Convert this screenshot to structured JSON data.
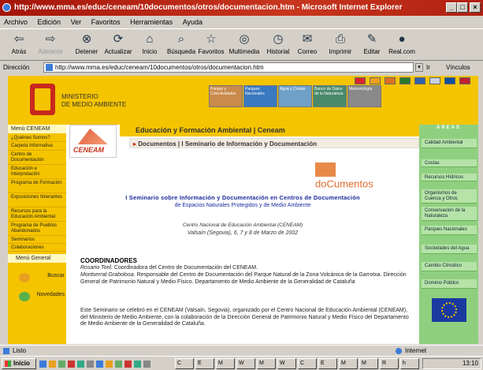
{
  "window": {
    "title": "http://www.mma.es/educ/ceneam/10documentos/otros/documentacion.htm - Microsoft Internet Explorer",
    "controls": [
      "_",
      "□",
      "×"
    ]
  },
  "menu": [
    "Archivo",
    "Edición",
    "Ver",
    "Favoritos",
    "Herramientas",
    "Ayuda"
  ],
  "toolbar": [
    {
      "label": "Atrás",
      "icon": "back-arrow-icon",
      "glyph": "⇦"
    },
    {
      "label": "Adelante",
      "icon": "forward-arrow-icon",
      "glyph": "⇨"
    },
    {
      "label": "Detener",
      "icon": "stop-icon",
      "glyph": "⊗"
    },
    {
      "label": "Actualizar",
      "icon": "refresh-icon",
      "glyph": "⟳"
    },
    {
      "label": "Inicio",
      "icon": "home-icon",
      "glyph": "⌂"
    },
    {
      "label": "Búsqueda",
      "icon": "search-icon",
      "glyph": "⌕"
    },
    {
      "label": "Favoritos",
      "icon": "favorites-icon",
      "glyph": "☆"
    },
    {
      "label": "Multimedia",
      "icon": "multimedia-icon",
      "glyph": "◎"
    },
    {
      "label": "Historial",
      "icon": "history-icon",
      "glyph": "◷"
    },
    {
      "label": "Correo",
      "icon": "mail-icon",
      "glyph": "✉"
    },
    {
      "label": "Imprimir",
      "icon": "print-icon",
      "glyph": "⎙"
    },
    {
      "label": "Editar",
      "icon": "edit-icon",
      "glyph": "✎"
    },
    {
      "label": "Real.com",
      "icon": "real-icon",
      "glyph": "●"
    }
  ],
  "address": {
    "label": "Dirección",
    "url": "http://www.mma.es/educ/ceneam/10documentos/otros/documentacion.htm",
    "go": "Ir",
    "links": "Vínculos"
  },
  "header": {
    "ministry_line1": "MINISTERIO",
    "ministry_line2": "DE MEDIO AMBIENTE",
    "photos": [
      "Parque y Colectividades",
      "Parques Nacionales",
      "Agua y Costas",
      "Banco de Datos de la Naturaleza",
      "Meteorología"
    ]
  },
  "left_nav": {
    "header": "Menú CENEAM",
    "items": [
      "¿Quiénes Somos?",
      "Carpeta Informativa",
      "Centro de Documentación",
      "Educación e Interpretación",
      "Programa de Formación",
      "Exposiciones Itinerantes",
      "Recursos para la Educación Ambiental",
      "Programa de Pueblos Abandonados",
      "Seminarios",
      "Colaboraciones"
    ],
    "footer": "Menú General",
    "search": "Buscar",
    "news": "Novedades"
  },
  "right_nav": {
    "header": "ÁREAS",
    "items": [
      "Calidad Ambiental",
      "Costas",
      "Recursos Hídricos",
      "Organismos de Cuenca y Otros",
      "Conservación de la Naturaleza",
      "Parques Nacionales",
      "Sociedades del Agua",
      "Cambio Climático",
      "Dominio Público"
    ]
  },
  "content": {
    "logo": "CENEAM",
    "section_title": "Educación y Formación Ambiental | Ceneam",
    "breadcrumb": "Documentos | I Seminario de Información y Documentación",
    "doc_logo": "doCumentos",
    "main_title": "I Seminario sobre Información y Documentación en Centros de Documentación",
    "subtitle": "de Espacios Naturales Protegidos y de Medio Ambiente",
    "org": "Centro Nacional de Educación Ambiental (CENEAM)",
    "place": "Valsaín (Segovia), 6, 7 y 8 de Marzo de 2002",
    "coord_heading": "COORDINADORES",
    "coord1_name": "Rosario Toril",
    "coord1_desc": ". Coordinadora del Centro de Documentación del CENEAM.",
    "coord2_name": "Montserrat Grabolosa",
    "coord2_desc": ". Responsable del Centro de Documentación del Parque Natural de la Zona Volcánica de la Garrotxa. Dirección General de Patrimonio Natural y Medio Físico. Departamento de Medio Ambiente de la Generalidad de Cataluña",
    "body": "Este Seminario se celebró en el CENEAM (Valsaín, Segovia), organizado por el Centro Nacional de Educación Ambiental (CENEAM), del Ministerio de Medio Ambiente, con la colaboración de la Dirección General de Patrimonio Natural y Medio Físico del Departamento de Medio Ambiente de la Generalidad de Cataluña."
  },
  "status": {
    "text": "Listo",
    "zone": "Internet"
  },
  "taskbar": {
    "start": "Inicio",
    "tasks": [
      "C",
      "E",
      "M",
      "W",
      "M",
      "W",
      "C",
      "E",
      "M",
      "M",
      "R",
      "h"
    ],
    "clock": "13:10"
  },
  "colors": {
    "titlebar": "#b02010",
    "yellow": "#f5c400",
    "green": "#8fd080",
    "link_blue": "#1a2a9a",
    "taskbar": "#d4d0c8"
  }
}
